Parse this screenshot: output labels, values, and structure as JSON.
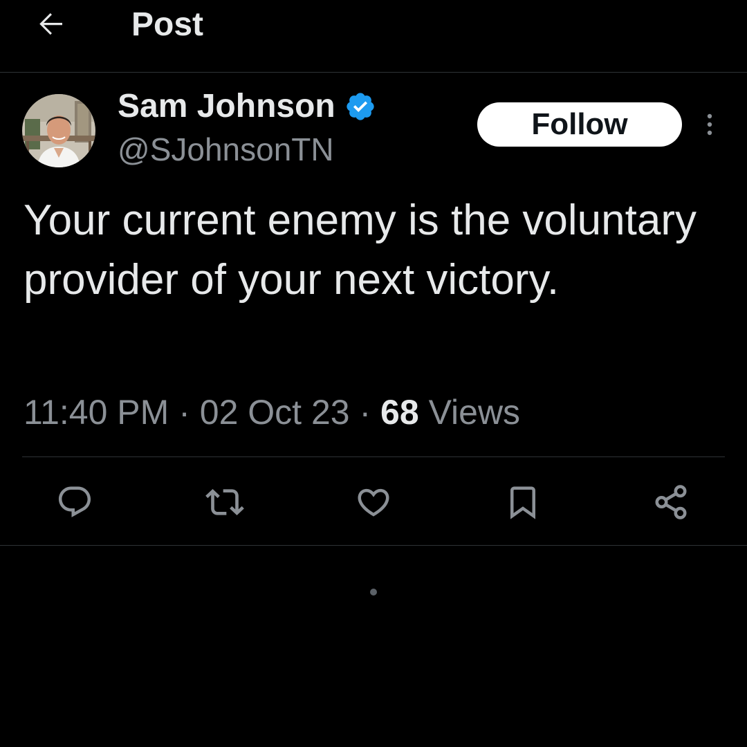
{
  "header": {
    "back_icon": "arrow-left-icon",
    "title": "Post"
  },
  "author": {
    "display_name": "Sam Johnson",
    "handle": "@SJohnsonTN",
    "verified": true,
    "verified_icon": "verified-badge-icon",
    "verified_color": "#1d9bf0"
  },
  "follow_button": {
    "label": "Follow"
  },
  "more_icon": "more-vertical-icon",
  "post": {
    "text": "Your current enemy is the voluntary provider of your next victory."
  },
  "meta": {
    "time": "11:40 PM",
    "separator": "·",
    "date": "02 Oct 23",
    "views_count": "68",
    "views_label": "Views"
  },
  "actions": [
    {
      "name": "reply",
      "icon": "reply-icon"
    },
    {
      "name": "repost",
      "icon": "repost-icon"
    },
    {
      "name": "like",
      "icon": "heart-icon"
    },
    {
      "name": "bookmark",
      "icon": "bookmark-icon"
    },
    {
      "name": "share",
      "icon": "share-icon"
    }
  ],
  "colors": {
    "background": "#000000",
    "text_primary": "#e7e9ea",
    "text_secondary": "#8b9096",
    "divider": "#2f3336",
    "accent": "#1d9bf0"
  }
}
